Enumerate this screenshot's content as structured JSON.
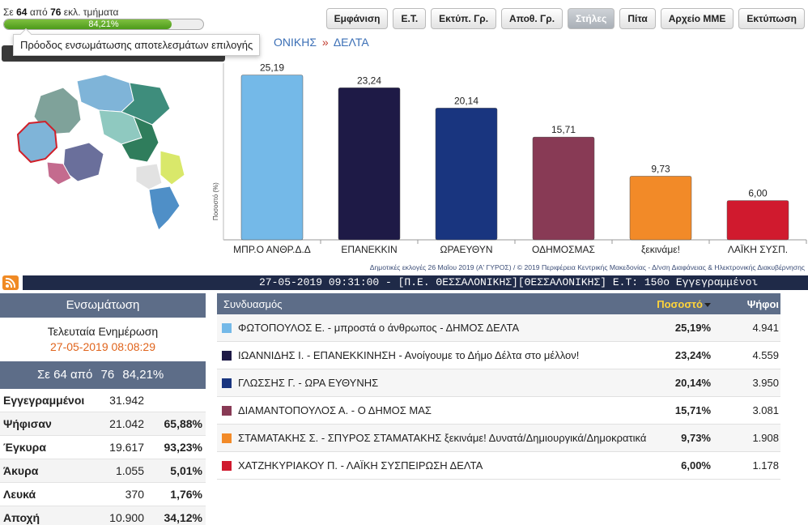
{
  "progress": {
    "prefix": "Σε",
    "counted": "64",
    "middle": "από",
    "total": "76",
    "suffix": "εκλ. τμήματα",
    "percent_text": "84,21%",
    "fraction": 0.8421,
    "tooltip": "Πρόοδος ενσωμάτωσης αποτελεσμάτων επιλογής"
  },
  "breadcrumb": {
    "region": "ΟΝΙΚΗΣ",
    "separator": "»",
    "municipality": "ΔΕΛΤΑ"
  },
  "toolbar": {
    "buttons": [
      "Εμφάνιση",
      "Ε.Τ.",
      "Εκτύπ. Γρ.",
      "Αποθ. Γρ.",
      "Στήλες",
      "Πίτα",
      "Αρχείο ΜΜΕ",
      "Εκτύπωση"
    ],
    "active": "Στήλες"
  },
  "map": {
    "colors": [
      "#7fb4d8",
      "#3e8d7c",
      "#8fc9c0",
      "#2f7d5c",
      "#d9e86a",
      "#6a6f9b",
      "#c46b8e",
      "#e2e2e2",
      "#4f8fc7",
      "#7fa29a"
    ]
  },
  "chart_data": {
    "type": "bar",
    "categories": [
      "ΜΠΡ.Ο ΑΝΘΡ.Δ.Δ",
      "ΕΠΑΝΕΚΚΙΝ",
      "ΩΡΑΕΥΘΥΝ",
      "ΟΔΗΜΟΣΜΑΣ",
      "ξεκινάμε!",
      "ΛΑΪΚΗ ΣΥΣΠ."
    ],
    "values": [
      25.19,
      23.24,
      20.14,
      15.71,
      9.73,
      6.0
    ],
    "value_labels": [
      "25,19",
      "23,24",
      "20,14",
      "15,71",
      "9,73",
      "6,00"
    ],
    "colors": [
      "#74b9e8",
      "#1e1a46",
      "#19357f",
      "#883a55",
      "#f28a28",
      "#d01a2e"
    ],
    "ylabel": "Ποσοστό (%)",
    "ylim": [
      0,
      27
    ],
    "grid": false,
    "footnote": "Δημοτικές εκλογές 26 Μαΐου 2019 (Α' ΓΥΡΟΣ) / © 2019 Περιφέρεια Κεντρικής Μακεδονίας - Δ/νση Διαφάνειας & Ηλεκτρονικής Διακυβέρνησης"
  },
  "ticker": {
    "text": "27-05-2019 09:31:00 - [Π.Ε. ΘΕΣΣΑΛΟΝΙΚΗΣ][ΘΕΣΣΑΛΟΝΙΚΗΣ]  Ε.Τ: 150ο  Εγγεγραμμένοι"
  },
  "stats": {
    "title": "Ενσωμάτωση",
    "last_update_label": "Τελευταία Ενημέρωση",
    "last_update": "27-05-2019 08:08:29",
    "progress_line": [
      "Σε 64 από",
      "76",
      "84,21%"
    ],
    "rows": [
      {
        "key": "Εγγεγραμμένοι",
        "value": "31.942",
        "pct": ""
      },
      {
        "key": "Ψήφισαν",
        "value": "21.042",
        "pct": "65,88%"
      },
      {
        "key": "Έγκυρα",
        "value": "19.617",
        "pct": "93,23%"
      },
      {
        "key": "Άκυρα",
        "value": "1.055",
        "pct": "5,01%"
      },
      {
        "key": "Λευκά",
        "value": "370",
        "pct": "1,76%"
      },
      {
        "key": "Αποχή",
        "value": "10.900",
        "pct": "34,12%"
      }
    ]
  },
  "results": {
    "headers": [
      "Συνδυασμός",
      "Ποσοστό",
      "Ψήφοι"
    ],
    "rows": [
      {
        "name": "ΦΩΤΟΠΟΥΛΟΣ Ε. - μπροστά ο άνθρωπος - ΔΗΜΟΣ ΔΕΛΤΑ",
        "pct": "25,19%",
        "votes": "4.941",
        "color": "#74b9e8"
      },
      {
        "name": "ΙΩΑΝΝΙΔΗΣ Ι. - ΕΠΑΝΕΚΚΙΝΗΣΗ - Ανοίγουμε το Δήμο Δέλτα στο μέλλον!",
        "pct": "23,24%",
        "votes": "4.559",
        "color": "#1e1a46"
      },
      {
        "name": "ΓΛΩΣΣΗΣ Γ. - ΩΡΑ ΕΥΘΥΝΗΣ",
        "pct": "20,14%",
        "votes": "3.950",
        "color": "#19357f"
      },
      {
        "name": "ΔΙΑΜΑΝΤΟΠΟΥΛΟΣ Α. - Ο ΔΗΜΟΣ ΜΑΣ",
        "pct": "15,71%",
        "votes": "3.081",
        "color": "#883a55"
      },
      {
        "name": "ΣΤΑΜΑΤΑΚΗΣ Σ. - ΣΠΥΡΟΣ ΣΤΑΜΑΤΑΚΗΣ ξεκινάμε! Δυνατά/Δημιουργικά/Δημοκρατικά",
        "pct": "9,73%",
        "votes": "1.908",
        "color": "#f28a28"
      },
      {
        "name": "ΧΑΤΖΗΚΥΡΙΑΚΟΥ Π. - ΛΑΪΚΗ ΣΥΣΠΕΙΡΩΣΗ ΔΕΛΤΑ",
        "pct": "6,00%",
        "votes": "1.178",
        "color": "#d01a2e"
      }
    ]
  }
}
